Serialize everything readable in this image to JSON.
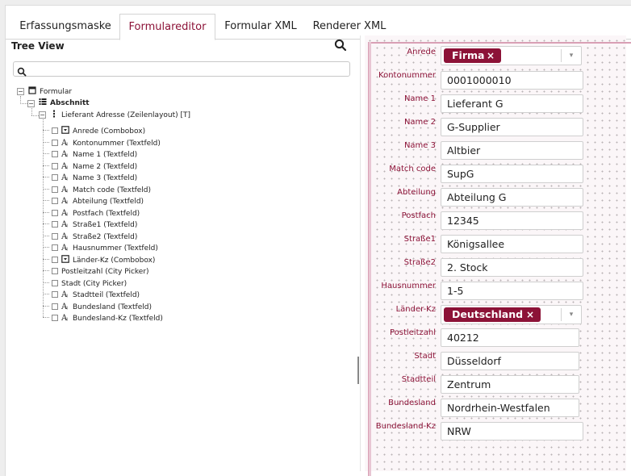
{
  "tabs": [
    {
      "label": "Erfassungsmaske",
      "active": false
    },
    {
      "label": "Formulareditor",
      "active": true
    },
    {
      "label": "Formular XML",
      "active": false
    },
    {
      "label": "Renderer XML",
      "active": false
    }
  ],
  "tree_panel": {
    "title": "Tree View",
    "search_icon": "search-icon",
    "search_value": ""
  },
  "tree": {
    "root": {
      "label": "Formular",
      "icon": "window-icon"
    },
    "section": {
      "label": "Abschnitt",
      "icon": "list-icon"
    },
    "group": {
      "label": "Lieferant Adresse (Zeilenlayout) [T]",
      "icon": "vertical-layout-icon"
    },
    "items": [
      {
        "label": "Anrede (Combobox)",
        "icon": "combobox-icon"
      },
      {
        "label": "Kontonummer (Textfeld)",
        "icon": "text-field-icon"
      },
      {
        "label": "Name 1 (Textfeld)",
        "icon": "text-field-icon"
      },
      {
        "label": "Name 2 (Textfeld)",
        "icon": "text-field-icon"
      },
      {
        "label": "Name 3 (Textfeld)",
        "icon": "text-field-icon"
      },
      {
        "label": "Match code (Textfeld)",
        "icon": "text-field-icon"
      },
      {
        "label": "Abteilung (Textfeld)",
        "icon": "text-field-icon"
      },
      {
        "label": "Postfach (Textfeld)",
        "icon": "text-field-icon"
      },
      {
        "label": "Straße1 (Textfeld)",
        "icon": "text-field-icon"
      },
      {
        "label": "Straße2 (Textfeld)",
        "icon": "text-field-icon"
      },
      {
        "label": "Hausnummer (Textfeld)",
        "icon": "text-field-icon"
      },
      {
        "label": "Länder-Kz (Combobox)",
        "icon": "combobox-icon"
      },
      {
        "label": "Postleitzahl (City Picker)",
        "icon": "none"
      },
      {
        "label": "Stadt (City Picker)",
        "icon": "none"
      },
      {
        "label": "Stadtteil (Textfeld)",
        "icon": "text-field-icon"
      },
      {
        "label": "Bundesland (Textfeld)",
        "icon": "text-field-icon"
      },
      {
        "label": "Bundesland-Kz (Textfeld)",
        "icon": "text-field-icon"
      }
    ]
  },
  "form": {
    "fields": [
      {
        "label": "Anrede",
        "type": "combo",
        "value": "Firma"
      },
      {
        "label": "Kontonummer",
        "type": "text",
        "value": "0001000010"
      },
      {
        "label": "Name 1",
        "type": "text",
        "value": "Lieferant G"
      },
      {
        "label": "Name 2",
        "type": "text",
        "value": "G-Supplier"
      },
      {
        "label": "Name 3",
        "type": "text",
        "value": "Altbier"
      },
      {
        "label": "Match code",
        "type": "text",
        "value": "SupG"
      },
      {
        "label": "Abteilung",
        "type": "text",
        "value": "Abteilung G"
      },
      {
        "label": "Postfach",
        "type": "text",
        "value": "12345"
      },
      {
        "label": "Straße1",
        "type": "text",
        "value": "Königsallee"
      },
      {
        "label": "Straße2",
        "type": "text",
        "value": "2. Stock"
      },
      {
        "label": "Hausnummer",
        "type": "text",
        "value": "1-5"
      },
      {
        "label": "Länder-Kz",
        "type": "combo",
        "value": "Deutschland"
      },
      {
        "label": "Postleitzahl",
        "type": "text",
        "value": "40212"
      },
      {
        "label": "Stadt",
        "type": "text",
        "value": "Düsseldorf"
      },
      {
        "label": "Stadtteil",
        "type": "text",
        "value": "Zentrum"
      },
      {
        "label": "Bundesland",
        "type": "text",
        "value": "Nordrhein-Westfalen"
      },
      {
        "label": "Bundesland-Kz",
        "type": "text",
        "value": "NRW"
      }
    ],
    "chip_remove_glyph": "×",
    "dropdown_glyph": "▾"
  },
  "colors": {
    "accent": "#8c1237",
    "canvas_bg": "#fbf6f8",
    "border": "#d4d4d4"
  }
}
